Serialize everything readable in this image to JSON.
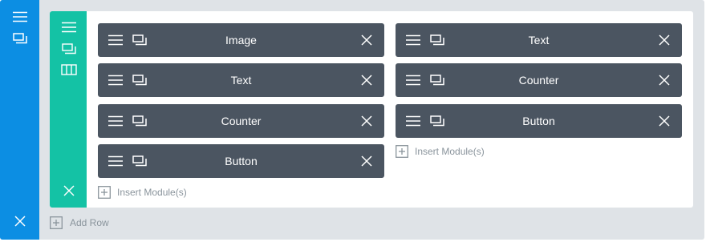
{
  "section": {
    "menu_icon": "hamburger-icon",
    "duplicate_icon": "duplicate-icon",
    "delete_icon": "close-icon",
    "add_row_label": "Add Row"
  },
  "row": {
    "menu_icon": "hamburger-icon",
    "duplicate_icon": "duplicate-icon",
    "columns_icon": "columns-icon",
    "delete_icon": "close-icon"
  },
  "columns": [
    {
      "modules": [
        {
          "label": "Image"
        },
        {
          "label": "Text"
        },
        {
          "label": "Counter"
        },
        {
          "label": "Button"
        }
      ],
      "insert_label": "Insert Module(s)"
    },
    {
      "modules": [
        {
          "label": "Text"
        },
        {
          "label": "Counter"
        },
        {
          "label": "Button"
        }
      ],
      "insert_label": "Insert Module(s)"
    }
  ],
  "colors": {
    "section_bar": "#0c8ee3",
    "row_bar": "#14c2a5",
    "module_bg": "#4b5561",
    "background": "#dfe3e7"
  }
}
